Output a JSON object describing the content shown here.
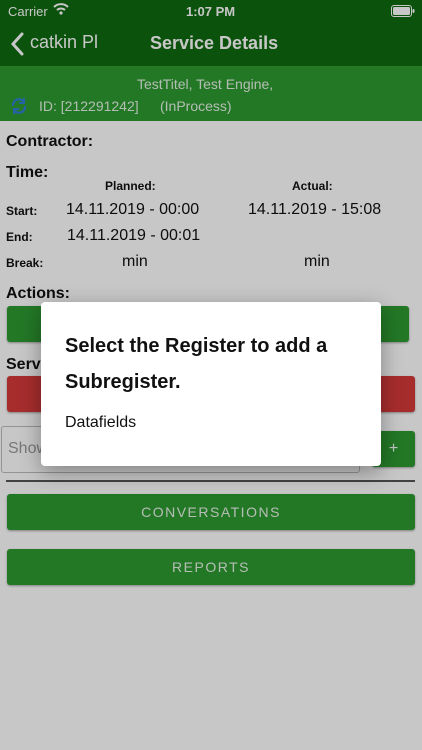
{
  "status": {
    "carrier": "Carrier",
    "time": "1:07 PM"
  },
  "nav": {
    "back_label": "catkin Pl",
    "title": "Service Details"
  },
  "service": {
    "title_line": "TestTitel, Test Engine,",
    "id_text": "ID: [212291242]",
    "status_text": "(InProcess)"
  },
  "labels": {
    "contractor": "Contractor:",
    "time": "Time:",
    "planned": "Planned:",
    "actual": "Actual:",
    "start": "Start:",
    "end": "End:",
    "break": "Break:",
    "actions": "Actions:",
    "serv_partial": "Serv",
    "show_partial": "Show"
  },
  "times": {
    "start_planned": "14.11.2019 - 00:00",
    "start_actual": "14.11.2019 - 15:08",
    "end_planned": "14.11.2019 - 00:01",
    "break_planned": "min",
    "break_actual": "min"
  },
  "buttons": {
    "add_label": "+",
    "conversations": "CONVERSATIONS",
    "reports": "REPORTS"
  },
  "dialog": {
    "title": "Select the Register to add a Subregister.",
    "option": "Datafields"
  },
  "colors": {
    "nav_bg": "#0f6a10",
    "header_bg": "#2e9a31",
    "button_green": "#2e9a31",
    "button_red": "#d63a3a"
  }
}
